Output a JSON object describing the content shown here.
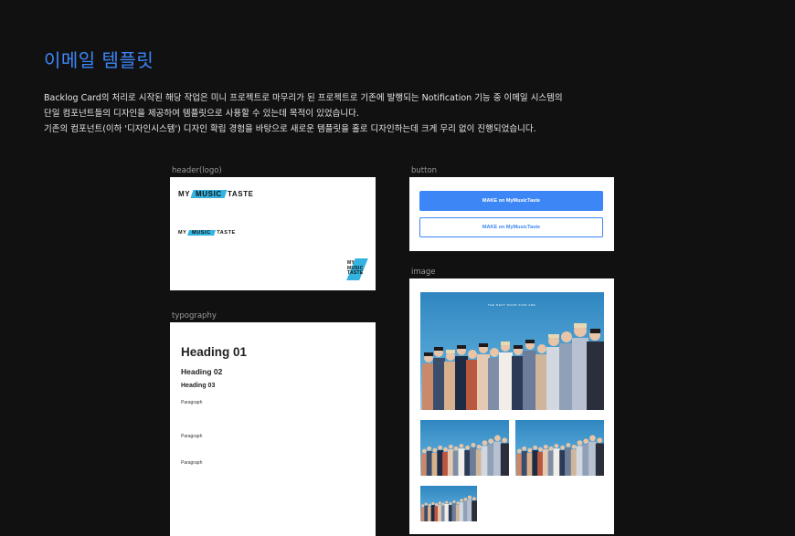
{
  "page": {
    "title": "이메일 템플릿",
    "description": [
      "Backlog Card의 처리로 시작된 해당 작업은 미니 프로젝트로 마무리가 된 프로젝트로 기존에 발행되는 Notification 기능 중 이메일 시스템의",
      "단일 컴포넌트들의 디자인을 제공하여 템플릿으로 사용할 수 있는데 목적이 있었습니다.",
      "기존의 컴포넌트(이하 '디자인시스템') 디자인 확립 경험을 바탕으로 새로운 템플릿을 홀로 디자인하는데 크게 무리 없이 진행되었습니다."
    ]
  },
  "sections": {
    "header_logo": {
      "label": "header(logo)",
      "logo_prefix": "MY",
      "logo_highlight": "MUSIC",
      "logo_suffix": "TASTE",
      "mark_lines": [
        "MY",
        "MUSIC",
        "TASTE"
      ],
      "accent_color": "#35b3e0"
    },
    "button": {
      "label": "button",
      "primary_label": "MAKE on MyMusicTaste",
      "outline_label": "MAKE on MyMusicTaste",
      "accent_color": "#3d86f6"
    },
    "typography": {
      "label": "typography",
      "heading1": "Heading 01",
      "heading2": "Heading 02",
      "heading3": "Heading 03",
      "paragraphs": [
        "Paragraph",
        "Paragraph",
        "Paragraph"
      ]
    },
    "image": {
      "label": "image",
      "banner_text": "THE NEXT DOOR KIDS ARE",
      "thumbnail_count": 4
    }
  }
}
